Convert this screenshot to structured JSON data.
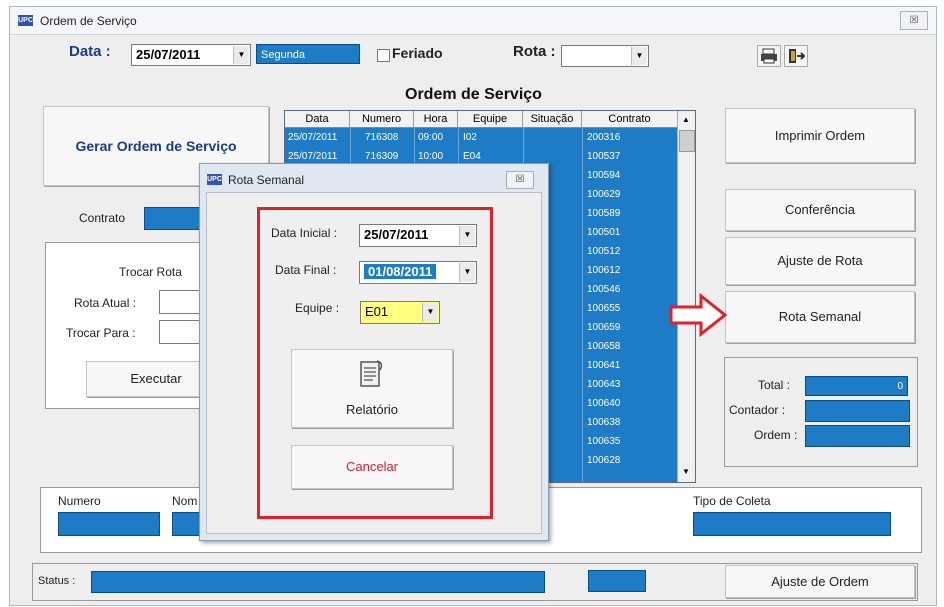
{
  "main_window": {
    "title": "Ordem de Serviço",
    "close_label": "☒",
    "toolbar": {
      "data_label": "Data :",
      "data_value": "25/07/2011",
      "weekday": "Segunda",
      "feriado_label": "Feriado",
      "rota_label": "Rota :",
      "rota_value": ""
    },
    "header_title": "Ordem de Serviço",
    "gerar_button": "Gerar Ordem de Serviço",
    "contrato_label": "Contrato",
    "trocar_rota": {
      "title": "Trocar Rota",
      "rota_atual_label": "Rota Atual :",
      "trocar_para_label": "Trocar Para :",
      "executar_button": "Executar"
    },
    "grid": {
      "columns": [
        "Data",
        "Numero",
        "Hora",
        "Equipe",
        "Situação",
        "Contrato"
      ],
      "rows": [
        {
          "data": "25/07/2011",
          "numero": "716308",
          "hora": "09:00",
          "equipe": "I02",
          "contrato": "200316"
        },
        {
          "data": "25/07/2011",
          "numero": "716309",
          "hora": "10:00",
          "equipe": "E04",
          "contrato": "100537"
        }
      ],
      "contratos": [
        "100594",
        "100629",
        "100589",
        "100501",
        "100512",
        "100612",
        "100546",
        "100655",
        "100659",
        "100658",
        "100641",
        "100643",
        "100640",
        "100638",
        "100635",
        "100628"
      ]
    },
    "right_buttons": {
      "imprimir": "Imprimir Ordem",
      "conferencia": "Conferência",
      "ajuste_rota": "Ajuste de Rota",
      "rota_semanal": "Rota Semanal"
    },
    "totals": {
      "total_label": "Total :",
      "total_value": "0",
      "contador_label": "Contador :",
      "ordem_label": "Ordem :"
    },
    "bottom": {
      "numero_label": "Numero",
      "nome_label": "Nom",
      "tipo_coleta_label": "Tipo de Coleta",
      "status_label": "Status :",
      "ajuste_ordem_button": "Ajuste de Ordem"
    }
  },
  "dialog": {
    "title": "Rota Semanal",
    "close_label": "☒",
    "data_inicial_label": "Data Inicial :",
    "data_inicial_value": "25/07/2011",
    "data_final_label": "Data Final :",
    "data_final_value": "01/08/2011",
    "equipe_label": "Equipe :",
    "equipe_value": "E01",
    "relatorio_button": "Relatório",
    "cancelar_button": "Cancelar"
  },
  "icons": [
    "app-icon",
    "printer-icon",
    "exit-icon",
    "report-icon",
    "red-arrow-icon"
  ],
  "colors": {
    "field_blue": "#1e7cc6",
    "highlight_red": "#e0202a",
    "header_blue": "#1a3a8c",
    "cancel_red": "#d8202a",
    "equipe_yellow": "#ffff80"
  }
}
